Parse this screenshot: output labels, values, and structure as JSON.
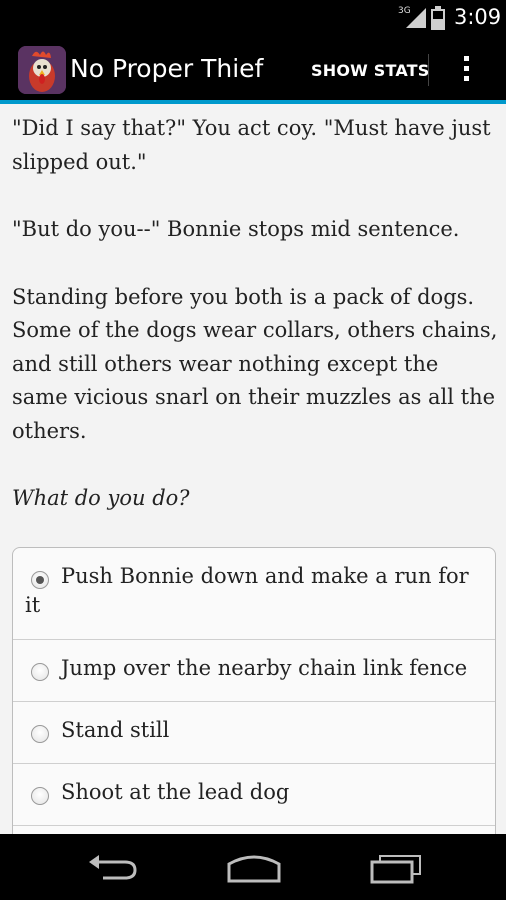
{
  "status_bar": {
    "network": "3G",
    "time": "3:09"
  },
  "action_bar": {
    "title": "No Proper Thief",
    "show_stats_label": "SHOW STATS",
    "app_icon": "rooster-icon",
    "overflow_icon": "overflow-menu-icon"
  },
  "accent_color": "#0099cc",
  "story": {
    "paragraphs": [
      "\"Did I say that?\" You act coy. \"Must have just slipped out.\"",
      "\"But do you--\" Bonnie stops mid sentence.",
      "Standing before you both is a pack of dogs. Some of the dogs wear collars, others chains, and still others wear nothing except the same vicious snarl on their muzzles as all the others."
    ],
    "prompt": "What do you do?"
  },
  "choices": [
    {
      "label": "Push Bonnie down and make a run for it",
      "selected": true
    },
    {
      "label": "Jump over the nearby chain link fence",
      "selected": false
    },
    {
      "label": "Stand still",
      "selected": false
    },
    {
      "label": "Shoot at the lead dog",
      "selected": false
    }
  ],
  "nav_bar": {
    "back_icon": "back-icon",
    "home_icon": "home-icon",
    "recents_icon": "recent-apps-icon"
  }
}
